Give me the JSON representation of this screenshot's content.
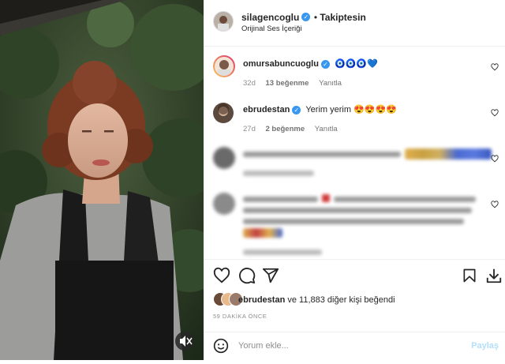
{
  "post": {
    "author": "silagencoglu",
    "follow_label": "Takiptesin",
    "audio": "Orijinal Ses İçeriği"
  },
  "comments": [
    {
      "user": "omursabuncuoglu",
      "text": "🧿🧿🧿💙",
      "age": "32d",
      "likes": "13 beğenme",
      "reply": "Yanıtla"
    },
    {
      "user": "ebrudestan",
      "text": "Yerim yerim 😍😍😍😍",
      "age": "27d",
      "likes": "2 beğenme",
      "reply": "Yanıtla"
    }
  ],
  "liked_by": {
    "user": "ebrudestan",
    "rest": " ve 11,883 diğer kişi beğendi"
  },
  "timestamp": "59 DAKİKA ÖNCE",
  "comment_box": {
    "placeholder": "Yorum ekle...",
    "post_label": "Paylaş"
  },
  "colors": {
    "accent": "#0095f6",
    "verified": "#3897f0",
    "muted": "#8e8e8e"
  },
  "icons": [
    "verified-badge-icon",
    "heart-icon",
    "comment-icon",
    "share-icon",
    "bookmark-icon",
    "download-icon",
    "emoji-icon",
    "mute-icon"
  ]
}
